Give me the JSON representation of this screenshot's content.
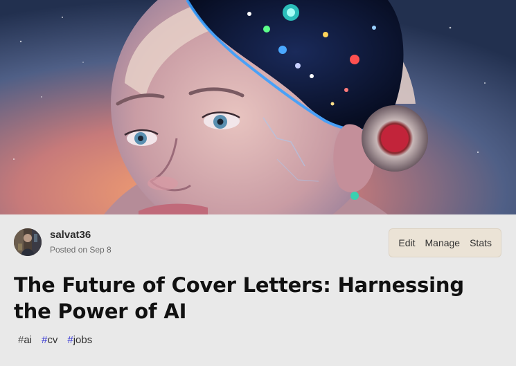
{
  "cover": {
    "alt": "AI woman with brain illustration"
  },
  "author": {
    "name": "salvat36",
    "posted": "Posted on Sep 8"
  },
  "actions": {
    "edit": "Edit",
    "manage": "Manage",
    "stats": "Stats"
  },
  "article": {
    "title": "The Future of Cover Letters: Harnessing the Power of AI"
  },
  "tags": [
    {
      "hash": "#",
      "name": "ai",
      "hash_color": "#555555"
    },
    {
      "hash": "#",
      "name": "cv",
      "hash_color": "#3b3bd4"
    },
    {
      "hash": "#",
      "name": "jobs",
      "hash_color": "#3b3bd4"
    }
  ]
}
